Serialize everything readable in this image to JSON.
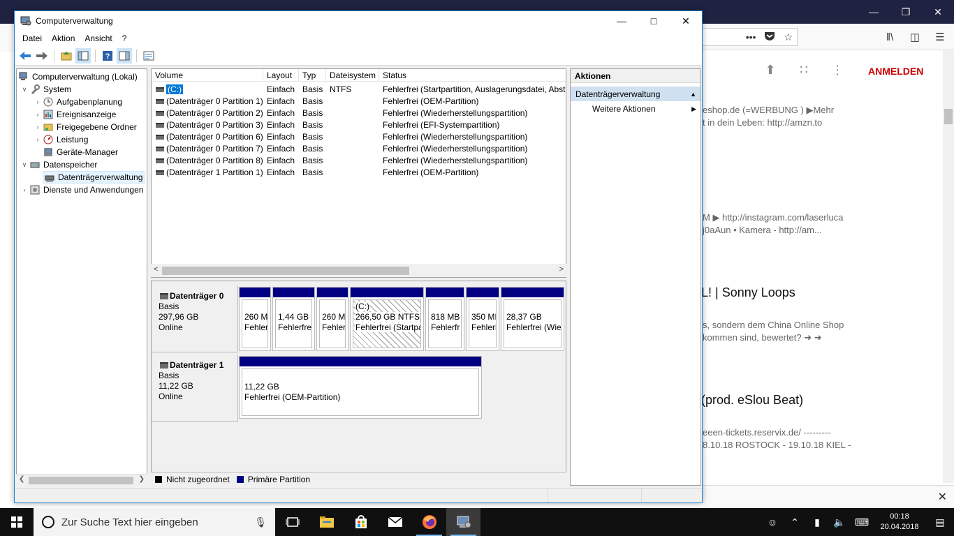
{
  "browser": {
    "toolbar_dots": "•••",
    "login_label": "ANMELDEN",
    "snippets": [
      "eshop.de (=WERBUNG ) ▶Mehr",
      "t in dein Leben: http://amzn.to",
      "M ▶ http://instagram.com/laserluca",
      "j0aAun • Kamera - http://am...",
      "s, sondern dem China Online Shop",
      "kommen sind, bewertet? ➜ ➜",
      "eeen-tickets.reservix.de/ ---------",
      "8.10.18 ROSTOCK - 19.10.18 KIEL -"
    ],
    "titles": [
      "L! | Sonny Loops",
      "(prod. eSlou Beat)"
    ]
  },
  "window": {
    "title": "Computerverwaltung",
    "menu": [
      "Datei",
      "Aktion",
      "Ansicht",
      "?"
    ]
  },
  "tree": {
    "root": "Computerverwaltung (Lokal)",
    "system": "System",
    "aufgaben": "Aufgabenplanung",
    "ereignis": "Ereignisanzeige",
    "freigegeben": "Freigegebene Ordner",
    "leistung": "Leistung",
    "geraete": "Geräte-Manager",
    "datenspeicher": "Datenspeicher",
    "datentraeger": "Datenträgerverwaltung",
    "dienste": "Dienste und Anwendungen"
  },
  "volumes": {
    "headers": [
      "Volume",
      "Layout",
      "Typ",
      "Dateisystem",
      "Status"
    ],
    "rows": [
      [
        "(C:)",
        "Einfach",
        "Basis",
        "NTFS",
        "Fehlerfrei (Startpartition, Auslagerungsdatei, Absturzabbild, Primäre Partition)"
      ],
      [
        "(Datenträger 0 Partition 1)",
        "Einfach",
        "Basis",
        "",
        "Fehlerfrei (OEM-Partition)"
      ],
      [
        "(Datenträger 0 Partition 2)",
        "Einfach",
        "Basis",
        "",
        "Fehlerfrei (Wiederherstellungspartition)"
      ],
      [
        "(Datenträger 0 Partition 3)",
        "Einfach",
        "Basis",
        "",
        "Fehlerfrei (EFI-Systempartition)"
      ],
      [
        "(Datenträger 0 Partition 6)",
        "Einfach",
        "Basis",
        "",
        "Fehlerfrei (Wiederherstellungspartition)"
      ],
      [
        "(Datenträger 0 Partition 7)",
        "Einfach",
        "Basis",
        "",
        "Fehlerfrei (Wiederherstellungspartition)"
      ],
      [
        "(Datenträger 0 Partition 8)",
        "Einfach",
        "Basis",
        "",
        "Fehlerfrei (Wiederherstellungspartition)"
      ],
      [
        "(Datenträger 1 Partition 1)",
        "Einfach",
        "Basis",
        "",
        "Fehlerfrei (OEM-Partition)"
      ]
    ]
  },
  "disks": {
    "d0": {
      "name": "Datenträger 0",
      "type": "Basis",
      "size": "297,96 GB",
      "state": "Online"
    },
    "d1": {
      "name": "Datenträger 1",
      "type": "Basis",
      "size": "11,22 GB",
      "state": "Online"
    },
    "d0_parts": [
      {
        "l1": "",
        "l2": "260 M",
        "l3": "Fehler"
      },
      {
        "l1": "",
        "l2": "1,44 GB",
        "l3": "Fehlerfre"
      },
      {
        "l1": "",
        "l2": "260 M",
        "l3": "Fehler"
      },
      {
        "l1": "(C:)",
        "l2": "266,50 GB NTFS",
        "l3": "Fehlerfrei (Startpa"
      },
      {
        "l1": "",
        "l2": "818 MB",
        "l3": "Fehlerfr"
      },
      {
        "l1": "",
        "l2": "350 MI",
        "l3": "Fehlerl"
      },
      {
        "l1": "",
        "l2": "28,37 GB",
        "l3": "Fehlerfrei (Wie"
      }
    ],
    "d1_part": {
      "l1": "",
      "l2": "11,22 GB",
      "l3": "Fehlerfrei (OEM-Partition)"
    }
  },
  "legend": {
    "unassigned": "Nicht zugeordnet",
    "primary": "Primäre Partition",
    "unassigned_color": "#000000",
    "primary_color": "#000080"
  },
  "actions": {
    "header": "Aktionen",
    "section": "Datenträgerverwaltung",
    "more": "Weitere Aktionen"
  },
  "taskbar": {
    "search_placeholder": "Zur Suche Text hier eingeben",
    "time": "00:18",
    "date": "20.04.2018"
  }
}
